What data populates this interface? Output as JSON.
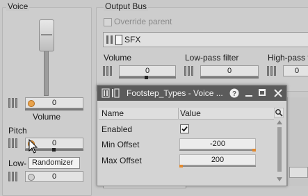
{
  "voice_panel": {
    "title": "Voice",
    "volume_value": "0",
    "volume_label": "Volume",
    "pitch_label": "Pitch",
    "pitch_value": "0",
    "lowpass_label_partial": "Low-",
    "lowpass_value": "0"
  },
  "tooltip": {
    "text": "Randomizer"
  },
  "output_bus": {
    "title": "Output Bus",
    "override_parent_label": "Override parent",
    "bus_name": "SFX",
    "volume_label": "Volume",
    "volume_value": "0",
    "lowpass_label": "Low-pass filter",
    "lowpass_value": "0",
    "highpass_label": "High-pass f",
    "highpass_value": "0"
  },
  "floating_window": {
    "title": "Footstep_Types - Voice ...",
    "columns": {
      "name": "Name",
      "value": "Value"
    },
    "rows": [
      {
        "name": "Enabled",
        "checked": true
      },
      {
        "name": "Min Offset",
        "value": "-200"
      },
      {
        "name": "Max Offset",
        "value": "200"
      }
    ]
  },
  "bottom_partial_value": "0",
  "colors": {
    "title_bar": "#5b5b5b",
    "accent_orange": "#e3892d",
    "background": "#c9c9c9"
  }
}
